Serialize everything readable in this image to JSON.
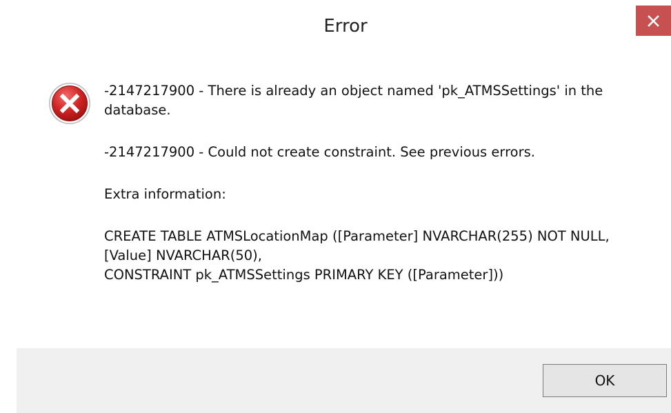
{
  "dialog": {
    "title": "Error",
    "close_glyph": "×",
    "icon": "error-circle-x-icon",
    "messages": [
      "-2147217900 - There is already an object named 'pk_ATMSSettings' in the database.",
      "-2147217900 - Could not create constraint. See previous errors.",
      "Extra information:"
    ],
    "sql_lines": [
      "CREATE TABLE ATMSLocationMap ([Parameter] NVARCHAR(255) NOT NULL,",
      "[Value] NVARCHAR(50),",
      "CONSTRAINT pk_ATMSSettings PRIMARY KEY ([Parameter]))"
    ],
    "ok_label": "OK"
  },
  "colors": {
    "close_button": "#c75050",
    "icon_red": "#c41a1a",
    "footer": "#f0f0f0"
  }
}
